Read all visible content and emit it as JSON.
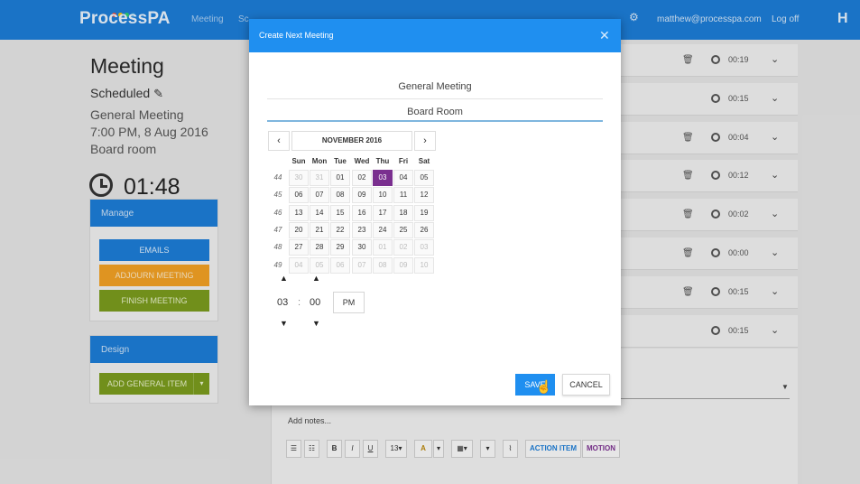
{
  "app": {
    "logo": "ProcessPA",
    "nav_items": [
      "Meeting",
      "Sc",
      "",
      ""
    ],
    "user_email": "matthew@processpa.com",
    "logoff_label": "Log off",
    "brand_mark": "H"
  },
  "meeting": {
    "title": "Meeting",
    "status": "Scheduled",
    "name": "General Meeting",
    "datetime": "7:00 PM, 8 Aug 2016",
    "location": "Board room",
    "timer": "01:48"
  },
  "manage": {
    "header": "Manage",
    "emails_label": "EMAILS",
    "adjourn_label": "ADJOURN MEETING",
    "finish_label": "FINISH MEETING"
  },
  "design": {
    "header": "Design",
    "add_item_label": "ADD GENERAL ITEM"
  },
  "agenda_rows": [
    {
      "time": "00:19",
      "trash": true
    },
    {
      "time": "00:15",
      "trash": false
    },
    {
      "time": "00:04",
      "trash": true
    },
    {
      "time": "00:12",
      "trash": true
    },
    {
      "time": "00:02",
      "trash": true
    },
    {
      "time": "00:00",
      "trash": true
    },
    {
      "time": "00:15",
      "trash": true
    },
    {
      "time": "00:15",
      "trash": false
    }
  ],
  "editor": {
    "notes_placeholder": "Add notes...",
    "toolbar": {
      "font_size": "13",
      "action_item": "ACTION ITEM",
      "motion": "MOTION"
    }
  },
  "modal": {
    "title": "Create Next Meeting",
    "meeting_type": "General Meeting",
    "location": "Board Room",
    "calendar": {
      "month_label": "NOVEMBER 2016",
      "weekday_headers": [
        "Sun",
        "Mon",
        "Tue",
        "Wed",
        "Thu",
        "Fri",
        "Sat"
      ],
      "weeks": [
        {
          "num": "44",
          "days": [
            "30",
            "31",
            "01",
            "02",
            "03",
            "04",
            "05"
          ],
          "muted": [
            true,
            true,
            false,
            false,
            false,
            false,
            false
          ]
        },
        {
          "num": "45",
          "days": [
            "06",
            "07",
            "08",
            "09",
            "10",
            "11",
            "12"
          ],
          "muted": [
            false,
            false,
            false,
            false,
            false,
            false,
            false
          ]
        },
        {
          "num": "46",
          "days": [
            "13",
            "14",
            "15",
            "16",
            "17",
            "18",
            "19"
          ],
          "muted": [
            false,
            false,
            false,
            false,
            false,
            false,
            false
          ]
        },
        {
          "num": "47",
          "days": [
            "20",
            "21",
            "22",
            "23",
            "24",
            "25",
            "26"
          ],
          "muted": [
            false,
            false,
            false,
            false,
            false,
            false,
            false
          ]
        },
        {
          "num": "48",
          "days": [
            "27",
            "28",
            "29",
            "30",
            "01",
            "02",
            "03"
          ],
          "muted": [
            false,
            false,
            false,
            false,
            true,
            true,
            true
          ]
        },
        {
          "num": "49",
          "days": [
            "04",
            "05",
            "06",
            "07",
            "08",
            "09",
            "10"
          ],
          "muted": [
            true,
            true,
            true,
            true,
            true,
            true,
            true
          ]
        }
      ],
      "selected_day": "03"
    },
    "time": {
      "hour": "03",
      "separator": ":",
      "minute": "00",
      "meridiem": "PM"
    },
    "save_label": "SAVE",
    "cancel_label": "CANCEL",
    "close_icon": "close-icon"
  },
  "colors": {
    "accent": "#1c7cd5",
    "modal_header": "#1f8ff0",
    "selected_day": "#7a2f8f",
    "orange": "#f0a024",
    "green": "#7a9a1e"
  }
}
